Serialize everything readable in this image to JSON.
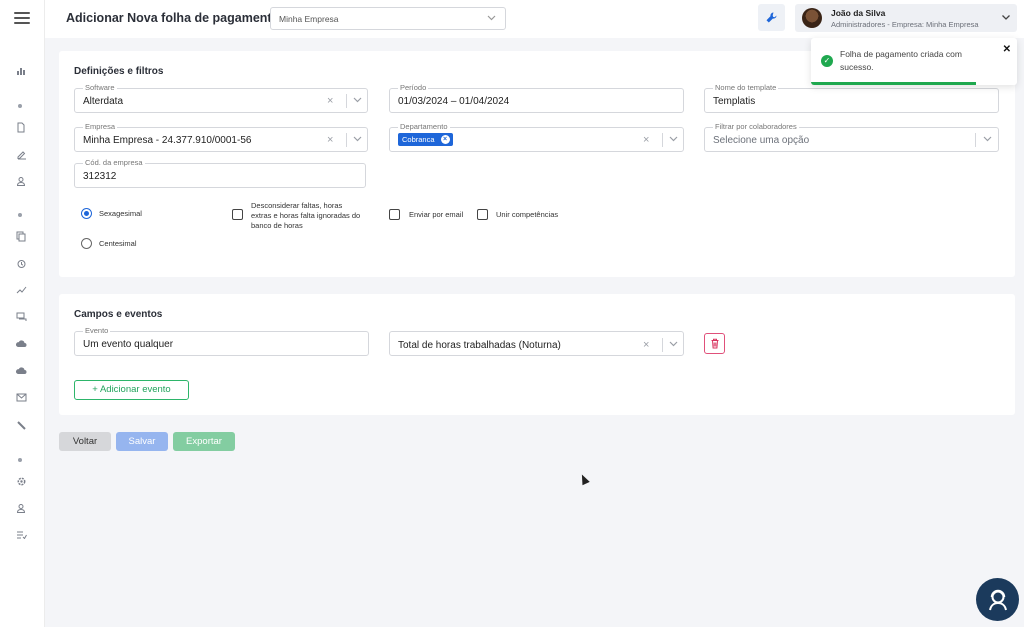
{
  "header": {
    "title": "Adicionar Nova folha de pagamento",
    "company": "Minha Empresa",
    "user_name": "João da Silva",
    "user_role": "Administradores - Empresa: Minha Empresa"
  },
  "filters": {
    "title": "Definições e filtros",
    "software_label": "Software",
    "software_value": "Alterdata",
    "periodo_label": "Período",
    "periodo_value": "01/03/2024 – 01/04/2024",
    "template_label": "Nome do template",
    "template_value": "Templatis",
    "empresa_label": "Empresa",
    "empresa_value": "Minha Empresa - 24.377.910/0001-56",
    "departamento_label": "Departamento",
    "departamento_tag": "Cobranca",
    "colaboradores_label": "Filtrar por colaboradores",
    "colaboradores_placeholder": "Selecione uma opção",
    "cod_label": "Cód. da empresa",
    "cod_value": "312312",
    "radio_sexagesimal": "Sexagesimal",
    "radio_centesimal": "Centesimal",
    "selected_radio": "Sexagesimal",
    "check_desconsiderar": "Desconsiderar faltas, horas extras e horas falta ignoradas do banco de horas",
    "check_email": "Enviar por email",
    "check_unir": "Unir competências"
  },
  "events": {
    "title": "Campos e eventos",
    "evento_label": "Evento",
    "evento_value": "Um evento qualquer",
    "campo_value": "Total de horas trabalhadas (Noturna)",
    "add_label": "+ Adicionar evento"
  },
  "actions": {
    "back": "Voltar",
    "save": "Salvar",
    "export": "Exportar"
  },
  "toast": {
    "message": "Folha de pagamento criada com sucesso.",
    "progress": 0.8
  },
  "colors": {
    "primary": "#1e66d9",
    "success": "#1fa84f",
    "danger": "#d8345f"
  }
}
